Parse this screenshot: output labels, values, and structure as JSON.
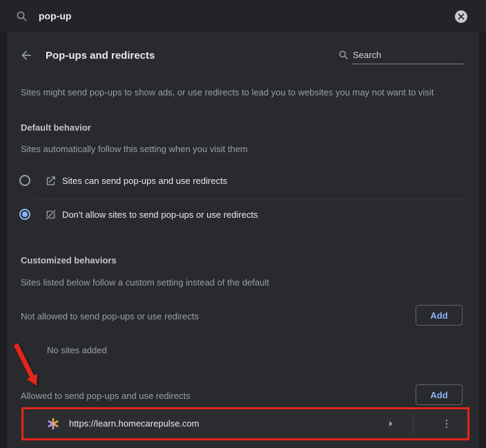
{
  "topbar": {
    "query": "pop-up"
  },
  "header": {
    "title": "Pop-ups and redirects",
    "search_placeholder": "Search"
  },
  "intro": "Sites might send pop-ups to show ads, or use redirects to lead you to websites you may not want to visit",
  "default_behavior": {
    "title": "Default behavior",
    "description": "Sites automatically follow this setting when you visit them",
    "options": [
      {
        "label": "Sites can send pop-ups and use redirects",
        "selected": false,
        "icon": "open-in-new-icon"
      },
      {
        "label": "Don't allow sites to send pop-ups or use redirects",
        "selected": true,
        "icon": "block-popup-icon"
      }
    ]
  },
  "customized": {
    "title": "Customized behaviors",
    "description": "Sites listed below follow a custom setting instead of the default",
    "not_allowed": {
      "label": "Not allowed to send pop-ups or use redirects",
      "button": "Add",
      "empty": "No sites added"
    },
    "allowed": {
      "label": "Allowed to send pop-ups and use redirects",
      "button": "Add",
      "sites": [
        {
          "url": "https://learn.homecarepulse.com"
        }
      ]
    }
  },
  "colors": {
    "accent": "#8ab4f8",
    "annotation_red": "#e4251b",
    "favicon_yellow": "#f2a93b",
    "favicon_purple": "#c29fe8"
  }
}
